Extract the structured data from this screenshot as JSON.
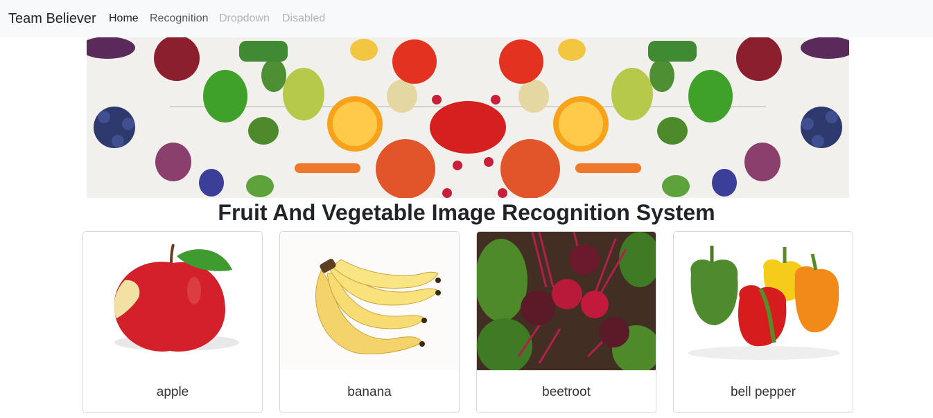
{
  "navbar": {
    "brand": "Team Believer",
    "items": [
      {
        "label": "Home",
        "state": "active"
      },
      {
        "label": "Recognition",
        "state": "normal"
      },
      {
        "label": "Dropdown",
        "state": "disabled"
      },
      {
        "label": "Disabled",
        "state": "disabled"
      }
    ]
  },
  "banner": {
    "icon": "fruit-vegetable-banner-image"
  },
  "main": {
    "title": "Fruit And Vegetable Image Recognition System",
    "cards": [
      {
        "label": "apple",
        "icon": "apple-image"
      },
      {
        "label": "banana",
        "icon": "banana-image"
      },
      {
        "label": "beetroot",
        "icon": "beetroot-image"
      },
      {
        "label": "bell pepper",
        "icon": "bell-pepper-image"
      }
    ]
  },
  "colors": {
    "navbar_bg": "#f8f9fa",
    "text": "#212529",
    "disabled_text": "#adb5bd",
    "card_border": "#d6d8db"
  }
}
